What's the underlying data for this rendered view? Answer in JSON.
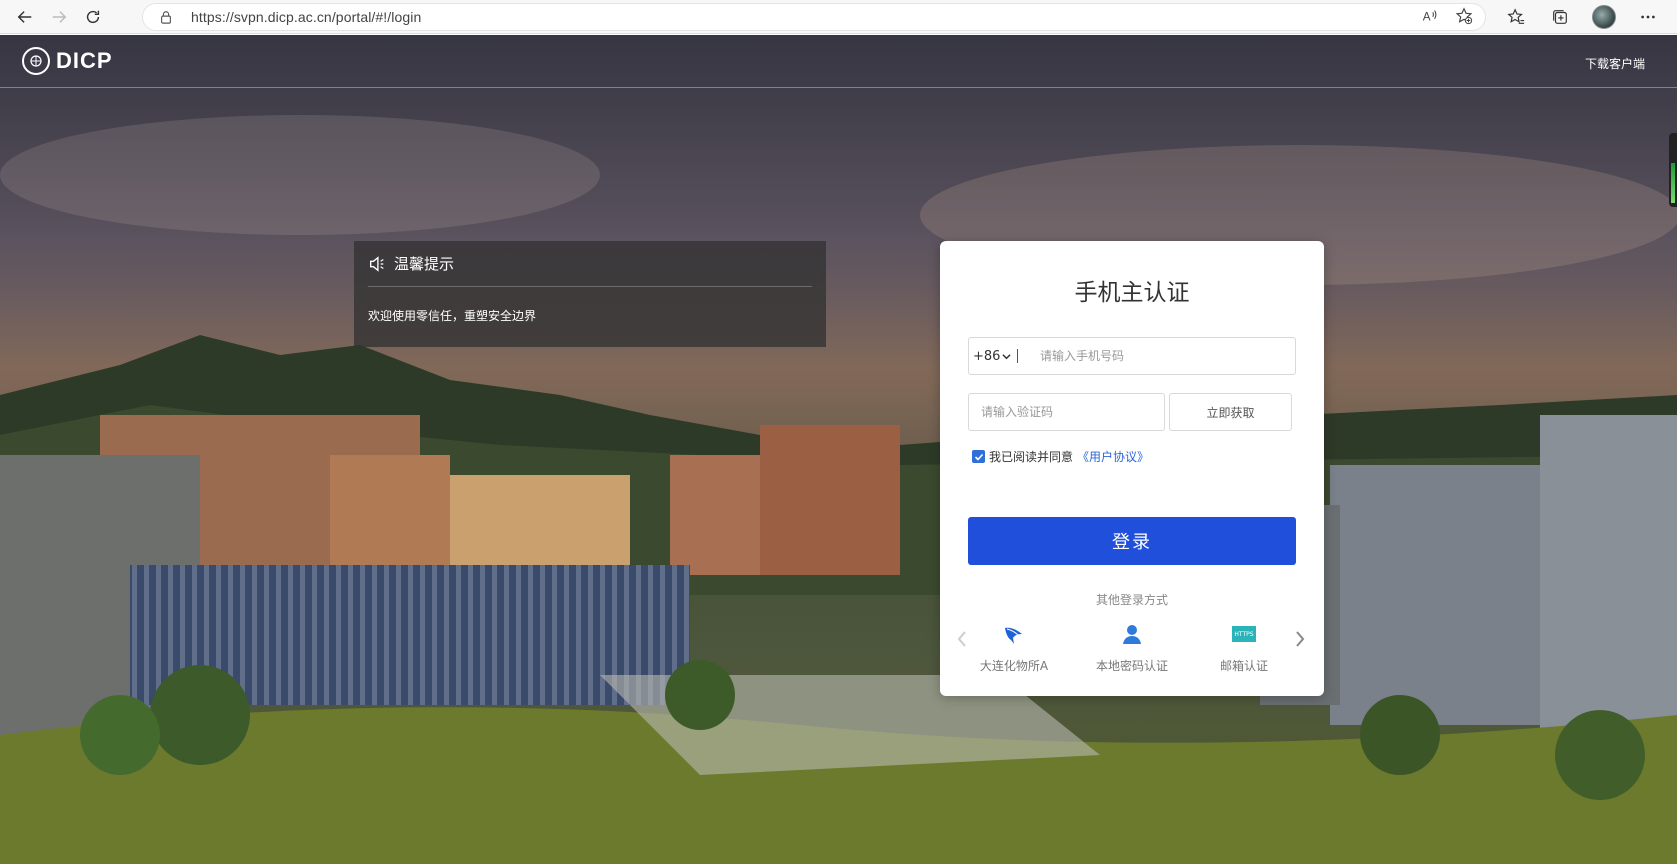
{
  "browser": {
    "url": "https://svpn.dicp.ac.cn/portal/#!/login"
  },
  "header": {
    "logo_text": "DICP",
    "download_label": "下载客户端"
  },
  "notice": {
    "title": "温馨提示",
    "body": "欢迎使用零信任，重塑安全边界"
  },
  "login": {
    "title": "手机主认证",
    "country_code": "+86",
    "phone_placeholder": "请输入手机号码",
    "code_placeholder": "请输入验证码",
    "get_code_label": "立即获取",
    "agree_text": "我已阅读并同意",
    "agreement_link": "《用户协议》",
    "agree_checked": true,
    "submit_label": "登录",
    "other_methods_title": "其他登录方式",
    "methods": [
      {
        "label": "大连化物所A",
        "icon": "feather-logo-icon"
      },
      {
        "label": "本地密码认证",
        "icon": "user-icon"
      },
      {
        "label": "邮箱认证",
        "icon": "https-icon",
        "icon_text": "HTTPS"
      }
    ]
  },
  "colors": {
    "primary": "#2050db",
    "link": "#2b66d9",
    "https_badge": "#2ab3b8"
  }
}
